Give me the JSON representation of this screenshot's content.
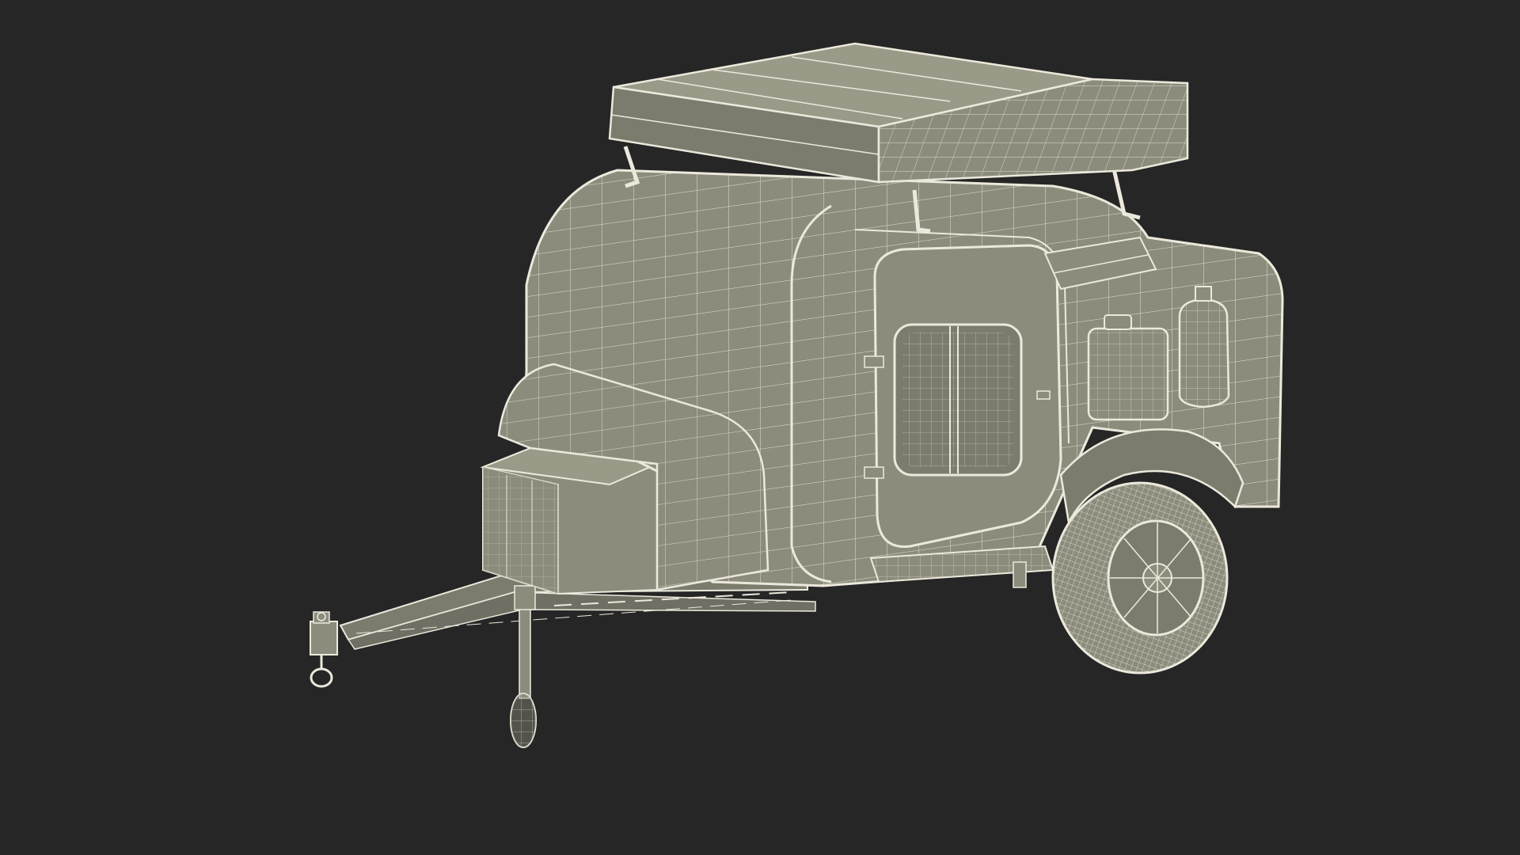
{
  "scene": {
    "background_color": "#262626",
    "surface_color": "#8c8c7c",
    "surface_dark_color": "#6f6f63",
    "wire_color": "#ece9dc",
    "render_style": "wireframe-on-shaded",
    "subject_icon": "off-road-teardrop-camper-trailer-icon"
  }
}
